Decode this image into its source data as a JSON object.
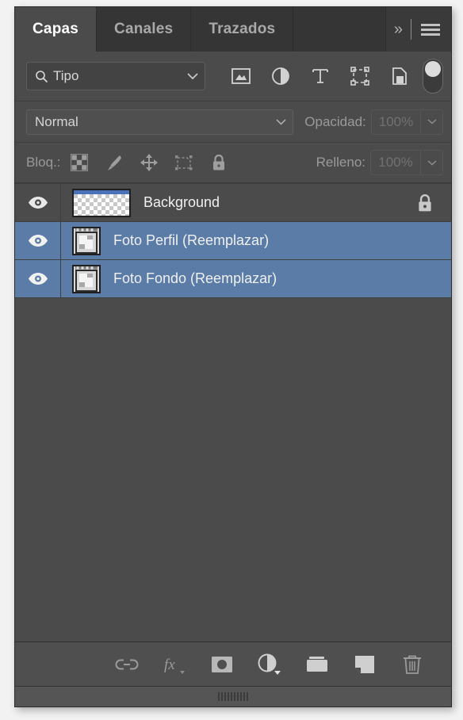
{
  "panel": {
    "tabs": [
      {
        "label": "Capas",
        "active": true
      },
      {
        "label": "Canales",
        "active": false
      },
      {
        "label": "Trazados",
        "active": false
      }
    ],
    "header_icons": {
      "collapse": "»",
      "collapse_name": "double-chevron-right-icon",
      "menu_name": "panel-menu-icon"
    }
  },
  "filter": {
    "search_icon": "search-icon",
    "type_label": "Tipo",
    "chevron": "chevron-down-icon",
    "filter_buttons": [
      {
        "name": "filter-pixel-layers",
        "title": "Pixel"
      },
      {
        "name": "filter-adjustment-layers",
        "title": "Ajuste"
      },
      {
        "name": "filter-type-layers",
        "title": "Texto"
      },
      {
        "name": "filter-shape-layers",
        "title": "Forma"
      },
      {
        "name": "filter-smart-object-layers",
        "title": "Objeto inteligente"
      }
    ],
    "toggle": {
      "name": "filter-enable-toggle",
      "state": "on"
    }
  },
  "blend": {
    "mode": "Normal",
    "mode_chevron": "chevron-down-icon",
    "opacity_label": "Opacidad:",
    "opacity_value": "100%",
    "opacity_chevron": "chevron-down-icon"
  },
  "lock": {
    "label": "Bloq.:",
    "buttons": [
      {
        "name": "lock-transparent-pixels-button",
        "icon": "checkerboard-icon"
      },
      {
        "name": "lock-image-pixels-button",
        "icon": "brush-icon"
      },
      {
        "name": "lock-position-button",
        "icon": "move-arrows-icon"
      },
      {
        "name": "lock-artboard-nesting-button",
        "icon": "artboard-icon"
      },
      {
        "name": "lock-all-button",
        "icon": "lock-icon"
      }
    ],
    "fill_label": "Relleno:",
    "fill_value": "100%",
    "fill_chevron": "chevron-down-icon"
  },
  "layers": [
    {
      "name": "Background",
      "visible": true,
      "selected": false,
      "locked": true,
      "thumb": "transparency-checkerboard",
      "thumb_wide": true
    },
    {
      "name": "Foto Perfil (Reemplazar)",
      "visible": true,
      "selected": true,
      "locked": false,
      "thumb": "smart-object-placeholder",
      "thumb_wide": false
    },
    {
      "name": "Foto Fondo (Reemplazar)",
      "visible": true,
      "selected": true,
      "locked": false,
      "thumb": "smart-object-placeholder",
      "thumb_wide": false
    }
  ],
  "bottom_toolbar": [
    {
      "name": "link-layers-button",
      "icon": "link-icon",
      "title": "Enlazar capas"
    },
    {
      "name": "layer-style-button",
      "icon": "fx-icon",
      "title": "Añadir estilo de capa"
    },
    {
      "name": "add-layer-mask-button",
      "icon": "layer-mask-icon",
      "title": "Añadir máscara de capa"
    },
    {
      "name": "new-adjustment-layer-button",
      "icon": "adjustment-circle-icon",
      "title": "Nueva capa de relleno o ajuste"
    },
    {
      "name": "new-group-button",
      "icon": "folder-icon",
      "title": "Crear grupo nuevo"
    },
    {
      "name": "new-layer-button",
      "icon": "new-layer-icon",
      "title": "Crear capa nueva"
    },
    {
      "name": "delete-layer-button",
      "icon": "trash-icon",
      "title": "Eliminar capa"
    }
  ],
  "colors": {
    "panel_bg": "#4b4b4b",
    "tab_bg": "#353535",
    "selection": "#5a7ca7",
    "text": "#f0f0f0",
    "muted_text": "#9a9a9a"
  }
}
